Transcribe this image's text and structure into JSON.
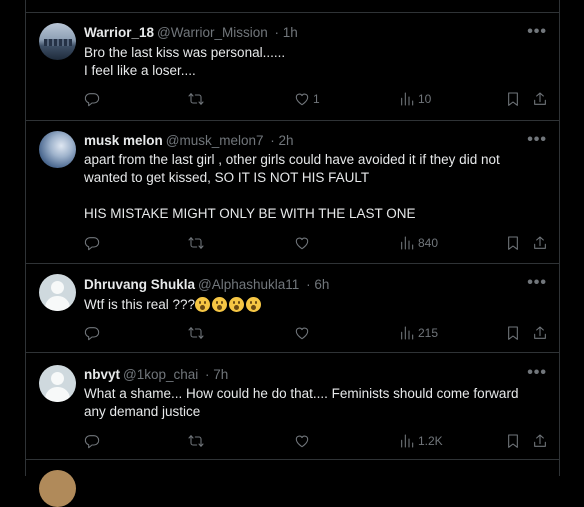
{
  "tweets": [
    {
      "name": "Warrior_18",
      "handle": "@Warrior_Mission",
      "time": "· 1h",
      "avatar": "city-skyline",
      "lines": [
        "Bro the last kiss was personal......",
        "I feel like a loser...."
      ],
      "likes": "1",
      "views": "10"
    },
    {
      "name": "musk melon",
      "handle": "@musk_melon7",
      "time": "· 2h",
      "avatar": "bird-photo",
      "lines": [
        "apart from the last girl , other girls could have avoided it if they did not",
        "wanted to get kissed, SO IT IS NOT HIS FAULT",
        "",
        "HIS MISTAKE MIGHT ONLY BE WITH THE LAST ONE"
      ],
      "likes": "",
      "views": "840"
    },
    {
      "name": "Dhruvang Shukla",
      "handle": "@Alphashukla11",
      "time": "· 6h",
      "avatar": "default-profile",
      "lines": [
        "Wtf is this real ???"
      ],
      "emoji_count": 4,
      "likes": "",
      "views": "215"
    },
    {
      "name": "nbvyt",
      "handle": "@1kop_chai",
      "time": "· 7h",
      "avatar": "default-profile",
      "lines": [
        "What a shame... How could he do that.... Feminists should come forward",
        "any demand justice"
      ],
      "likes": "",
      "views": "1.2K"
    }
  ],
  "icons": {
    "reply": "reply-icon",
    "retweet": "retweet-icon",
    "like": "like-icon",
    "views": "views-icon",
    "bookmark": "bookmark-icon",
    "share": "share-icon",
    "more": "more-icon"
  },
  "more_glyph": "•••",
  "colors": {
    "background": "#000000",
    "text": "#e7e9ea",
    "muted": "#71767b",
    "border": "#2f3336"
  }
}
